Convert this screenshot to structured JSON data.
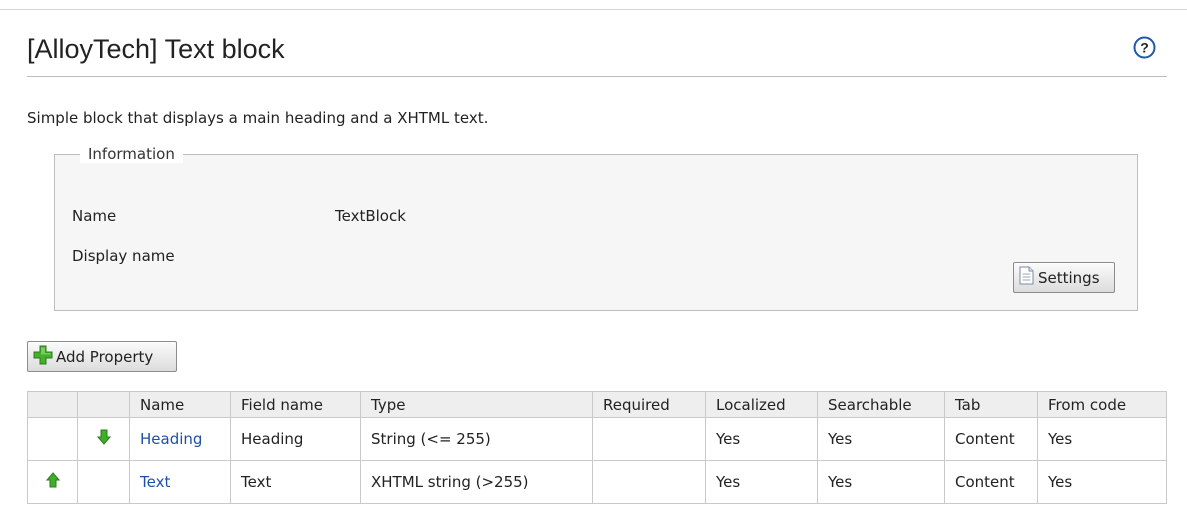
{
  "page": {
    "title": "[AlloyTech] Text block",
    "description": "Simple block that displays a main heading and a XHTML text."
  },
  "information": {
    "legend": "Information",
    "fields": [
      {
        "label": "Name",
        "value": "TextBlock"
      },
      {
        "label": "Display name",
        "value": ""
      }
    ],
    "settings_label": "Settings"
  },
  "toolbar": {
    "add_property_label": "Add Property"
  },
  "properties_table": {
    "columns": [
      "",
      "",
      "Name",
      "Field name",
      "Type",
      "Required",
      "Localized",
      "Searchable",
      "Tab",
      "From code"
    ],
    "rows": [
      {
        "move": "down-arrow-icon",
        "name": "Heading",
        "field_name": "Heading",
        "type": "String (<= 255)",
        "required": "",
        "localized": "Yes",
        "searchable": "Yes",
        "tab": "Content",
        "from_code": "Yes"
      },
      {
        "move": "up-arrow-icon",
        "name": "Text",
        "field_name": "Text",
        "type": "XHTML string (>255)",
        "required": "",
        "localized": "Yes",
        "searchable": "Yes",
        "tab": "Content",
        "from_code": "Yes"
      }
    ]
  },
  "icons": {
    "help": "help-icon",
    "settings": "document-icon",
    "add": "plus-icon"
  },
  "colors": {
    "link": "#1e4fa6",
    "arrow_green": "#3fae29",
    "plus_green": "#45b02e",
    "help_blue": "#1d5aa8"
  }
}
